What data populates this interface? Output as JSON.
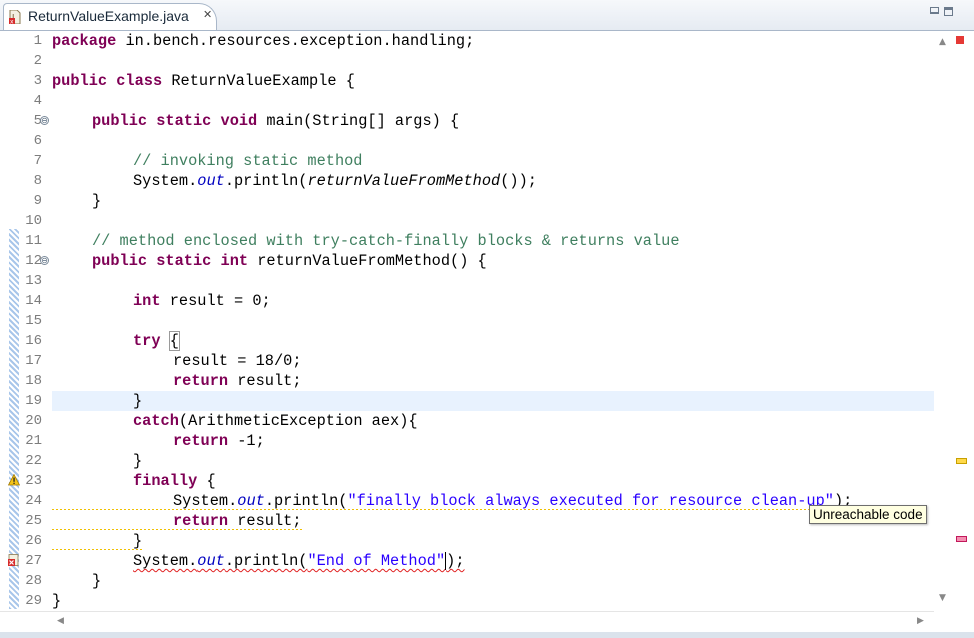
{
  "tab": {
    "title": "ReturnValueExample.java",
    "close_glyph": "✕",
    "icon": "java-file-error-icon"
  },
  "window_controls": {
    "minimize_icon": "minimize-icon",
    "maximize_icon": "maximize-icon"
  },
  "editor": {
    "line_numbers": [
      "1",
      "2",
      "3",
      "4",
      "5",
      "6",
      "7",
      "8",
      "9",
      "10",
      "11",
      "12",
      "13",
      "14",
      "15",
      "16",
      "17",
      "18",
      "19",
      "20",
      "21",
      "22",
      "23",
      "24",
      "25",
      "26",
      "27",
      "28",
      "29"
    ],
    "current_line": "19",
    "code": {
      "l1_kw": "package",
      "l1_rest": " in.bench.resources.exception.handling;",
      "l3_kw": "public class",
      "l3_rest": " ReturnValueExample {",
      "l5_kw": "public static void",
      "l5_rest": " main(String[] args) {",
      "l7_cm": "// invoking static method",
      "l8_a": "System.",
      "l8_field": "out",
      "l8_b": ".println(",
      "l8_call": "returnValueFromMethod",
      "l8_c": "());",
      "l9": "}",
      "l11_cm": "// method enclosed with try-catch-finally blocks & returns value",
      "l12_kw": "public static int",
      "l12_rest": " returnValueFromMethod() {",
      "l14_kw": "int",
      "l14_rest": " result = 0;",
      "l16_kw": "try",
      "l16_brace": "{",
      "l17": "result = 18/0;",
      "l18_kw": "return",
      "l18_rest": " result;",
      "l19_brace": "}",
      "l20_kw": "catch",
      "l20_rest": "(ArithmeticException aex){",
      "l21_kw": "return",
      "l21_rest": " -1;",
      "l22": "}",
      "l23_kw": "finally",
      "l23_rest": " {",
      "l24_a": "System.",
      "l24_field": "out",
      "l24_b": ".println(",
      "l24_str": "\"finally block always executed for resource clean-up\"",
      "l24_c": ");",
      "l25_kw": "return",
      "l25_rest": " result;",
      "l26": "}",
      "l27_a": "System.",
      "l27_field": "out",
      "l27_b": ".println(",
      "l27_str": "\"End of Method\"",
      "l27_c": ");",
      "l28": "}",
      "l29": "}"
    },
    "fold_glyph": "⊖"
  },
  "markers": {
    "warning_icon": "warning-icon",
    "error_icon": "error-icon",
    "warning_color": "#f0c000",
    "error_color": "#e02020"
  },
  "tooltip": {
    "text": "Unreachable code"
  },
  "colors": {
    "keyword": "#7f0055",
    "comment": "#3f7f5f",
    "string": "#2a00ff",
    "field": "#0000c0",
    "current_line_bg": "#e8f2fe"
  }
}
